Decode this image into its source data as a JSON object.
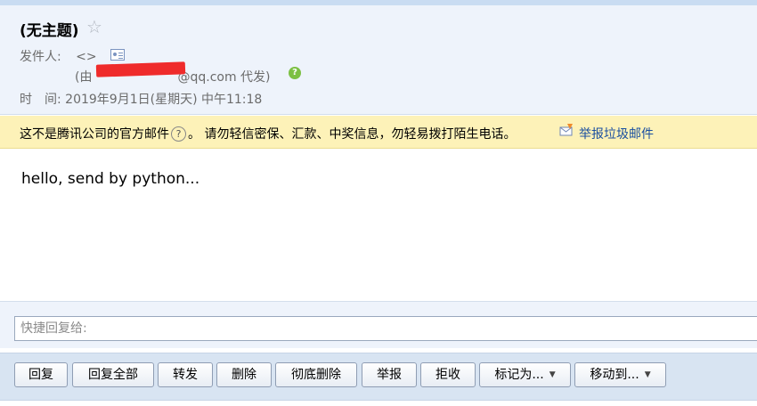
{
  "email": {
    "subject": "(无主题)",
    "star_glyph": "☆",
    "sender_label": "发件人:",
    "sender_value": "<>",
    "proxy_prefix": "(由",
    "proxy_suffix": "@qq.com 代发)",
    "time_label": "时　间:",
    "time_value": "2019年9月1日(星期天) 中午11:18",
    "body": "hello, send by python..."
  },
  "warning": {
    "text_before": "这不是腾讯公司的官方邮件",
    "help_glyph": "?",
    "text_after": "。 请勿轻信密保、汇款、中奖信息，勿轻易拨打陌生电话。",
    "report_link": "举报垃圾邮件"
  },
  "quick_reply": {
    "placeholder": "快捷回复给:"
  },
  "toolbar": {
    "reply": "回复",
    "reply_all": "回复全部",
    "forward": "转发",
    "delete": "删除",
    "delete_permanently": "彻底删除",
    "report": "举报",
    "reject": "拒收",
    "mark_as": "标记为...",
    "move_to": "移动到...",
    "dropdown_glyph": "▼"
  },
  "colors": {
    "header_bg": "#eef3fb",
    "warning_bg": "#fdf2b8",
    "link": "#1a4fa0",
    "redaction": "#ef2b2b",
    "verified_green": "#7cc043"
  }
}
